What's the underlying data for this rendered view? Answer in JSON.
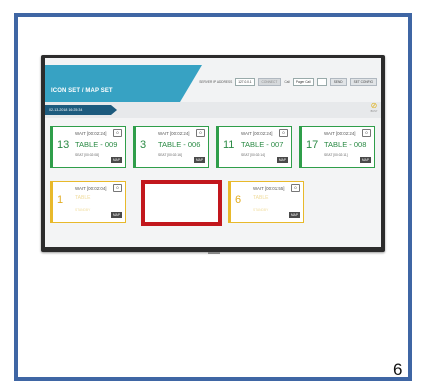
{
  "app": {
    "title": "ICON SET / MAP SET",
    "top_controls": {
      "server_ip_label": "SERVER IP ADDRESS",
      "server_ip_value": "127.0.0.1",
      "connect_button": "CONNECT",
      "call_label": "Call",
      "call_select_value": "Pager Call",
      "send_button": "SEND",
      "set_config_button": "SET CONFIG"
    },
    "date_time": "02-13-2018 16:25:34",
    "status_icon_caption": "BUSY"
  },
  "cards_row1": [
    {
      "number": "13",
      "wait": "WAIT [00:02:24]",
      "table": "TABLE - 009",
      "seat": "SEAT [00:02:08]",
      "badge": "0",
      "map": "MAP"
    },
    {
      "number": "3",
      "wait": "WAIT [00:02:24]",
      "table": "TABLE - 006",
      "seat": "SEAT [00:02:16]",
      "badge": "0",
      "map": "MAP"
    },
    {
      "number": "11",
      "wait": "WAIT [00:02:24]",
      "table": "TABLE - 007",
      "seat": "SEAT [00:02:14]",
      "badge": "0",
      "map": "MAP"
    },
    {
      "number": "17",
      "wait": "WAIT [00:02:24]",
      "table": "TABLE - 008",
      "seat": "SEAT [00:02:11]",
      "badge": "0",
      "map": "MAP"
    }
  ],
  "cards_row2": [
    {
      "number": "1",
      "wait": "WAIT [00:02:04]",
      "table": "TABLE",
      "seat": "STANDBY",
      "badge": "0",
      "map": "MAP"
    },
    {
      "number": "6",
      "wait": "WAIT [00:01:55]",
      "table": "TABLE",
      "seat": "STANDBY",
      "badge": "0",
      "map": "MAP"
    }
  ],
  "page_number": "6",
  "colors": {
    "frame": "#3f66a4",
    "accent_blue": "#37a2c3",
    "date_tab": "#1d5b7e",
    "active_green": "#2f9e4a",
    "waiting_yellow": "#e8b92b",
    "highlight_red": "#c2171d"
  }
}
